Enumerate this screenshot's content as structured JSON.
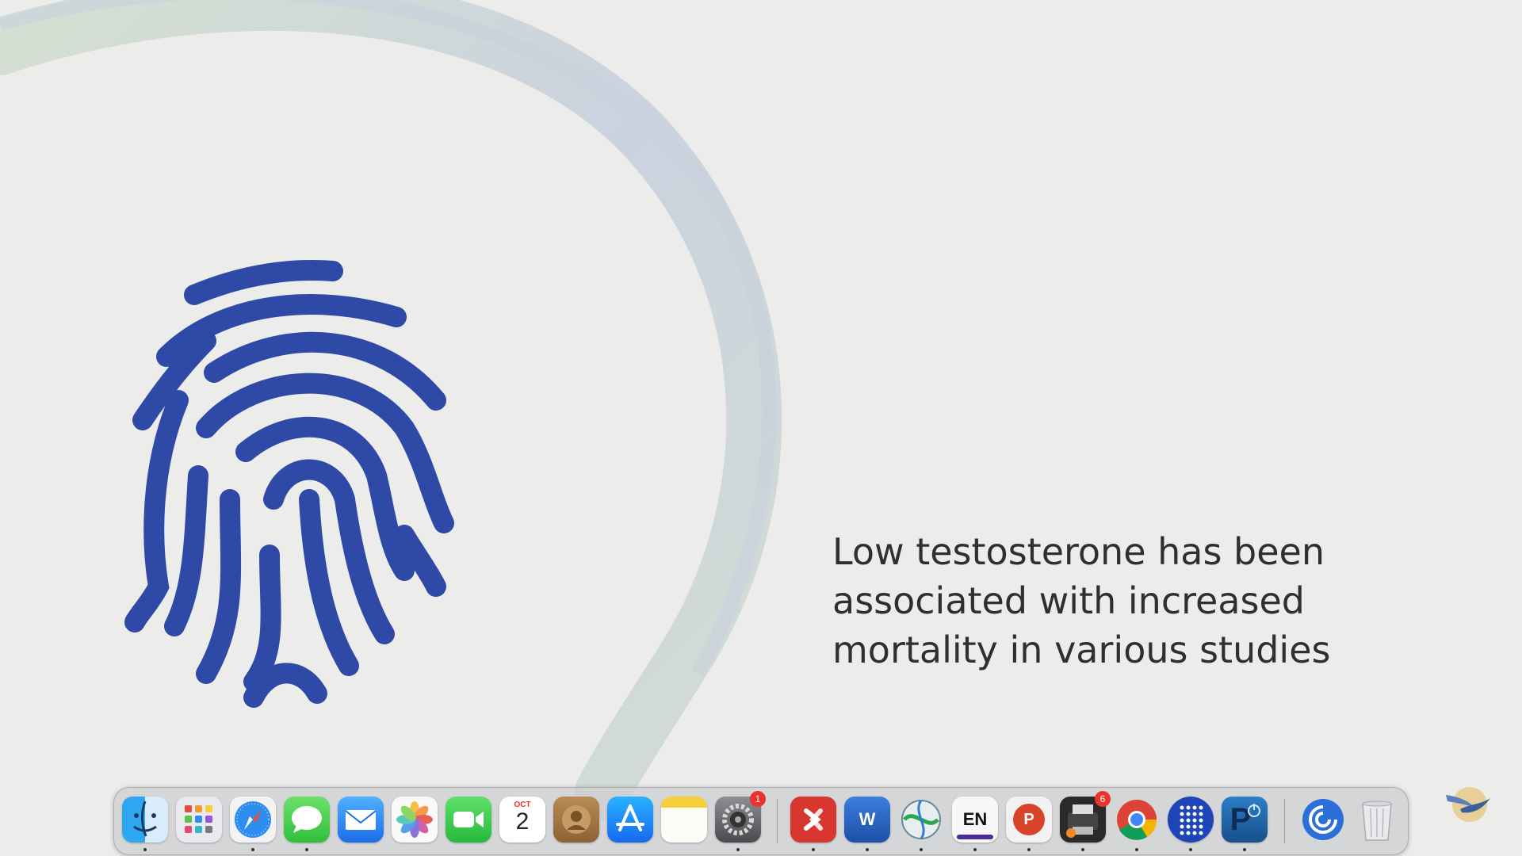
{
  "slide": {
    "text_lines": [
      "Low testosterone has been",
      "associated with increased",
      "mortality in various studies"
    ],
    "icon": "fingerprint-icon",
    "accent_color": "#2e4aa6"
  },
  "dock": {
    "apps": [
      {
        "name": "Finder",
        "icon": "finder-icon"
      },
      {
        "name": "Launchpad",
        "icon": "launchpad-icon"
      },
      {
        "name": "Safari",
        "icon": "safari-icon"
      },
      {
        "name": "Messages",
        "icon": "messages-icon"
      },
      {
        "name": "Mail",
        "icon": "mail-icon"
      },
      {
        "name": "Photos",
        "icon": "photos-icon"
      },
      {
        "name": "FaceTime",
        "icon": "facetime-icon"
      },
      {
        "name": "Calendar",
        "icon": "calendar-icon",
        "month": "OCT",
        "day": "2"
      },
      {
        "name": "Contacts",
        "icon": "contacts-icon"
      },
      {
        "name": "App Store",
        "icon": "app-store-icon"
      },
      {
        "name": "Notes",
        "icon": "notes-icon"
      },
      {
        "name": "System Settings",
        "icon": "settings-icon",
        "badge": "1"
      },
      {
        "name": "Remote Desktop",
        "icon": "remote-desktop-icon"
      },
      {
        "name": "Word",
        "icon": "word-icon",
        "label": "W"
      },
      {
        "name": "Network",
        "icon": "network-globe-icon"
      },
      {
        "name": "Input Source",
        "icon": "language-icon",
        "label": "EN"
      },
      {
        "name": "PowerPoint",
        "icon": "powerpoint-icon",
        "label": "P"
      },
      {
        "name": "Printer",
        "icon": "printer-icon",
        "badge": "6"
      },
      {
        "name": "Chrome",
        "icon": "chrome-icon"
      },
      {
        "name": "Dots App",
        "icon": "dots-app-icon"
      },
      {
        "name": "Power App",
        "icon": "power-app-icon",
        "label": "P"
      },
      {
        "name": "Downloads",
        "icon": "downloads-stack-icon"
      },
      {
        "name": "Trash",
        "icon": "trash-icon"
      }
    ]
  }
}
